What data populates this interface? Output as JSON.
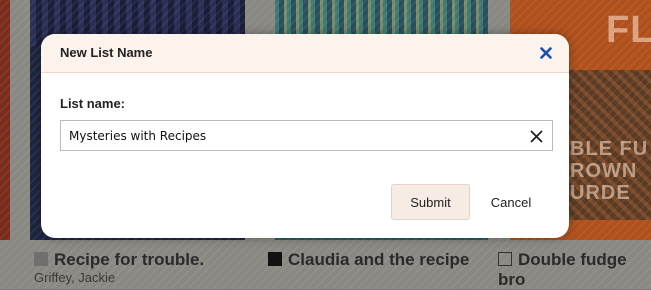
{
  "modal": {
    "title": "New List Name",
    "field_label": "List name:",
    "input_value": "Mysteries with Recipes",
    "submit_label": "Submit",
    "cancel_label": "Cancel",
    "close_icon": "close-icon",
    "clear_icon": "clear-icon"
  },
  "background": {
    "books": [
      {
        "title": "Recipe for trouble.",
        "author": "Griffey, Jackie",
        "checkbox": "gray"
      },
      {
        "title": "Claudia and the recipe",
        "checkbox": "black"
      },
      {
        "title": "Double fudge bro",
        "checkbox": "empty"
      }
    ],
    "cover_text_top": "FLU",
    "cover_text_mid": [
      "BLE FU",
      "ROWN",
      "URDE"
    ]
  },
  "colors": {
    "close_icon": "#1a4fb0",
    "modal_header_bg": "#fbf3ec",
    "submit_bg": "#f6ece4"
  }
}
